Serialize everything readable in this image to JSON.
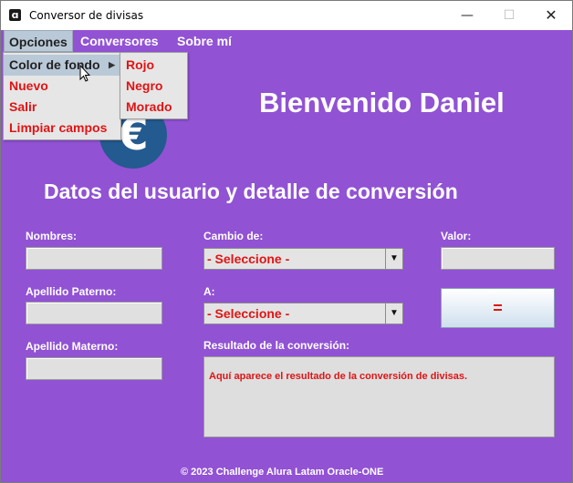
{
  "window": {
    "title": "Conversor de divisas",
    "app_icon": "ɑ",
    "minimize_glyph": "—",
    "maximize_glyph": "☐",
    "close_glyph": "✕"
  },
  "menubar": {
    "items": [
      {
        "label": "Opciones"
      },
      {
        "label": "Conversores"
      },
      {
        "label": "Sobre mí"
      }
    ]
  },
  "opciones_menu": {
    "items": [
      {
        "label": "Color de fondo",
        "has_submenu": true
      },
      {
        "label": "Nuevo"
      },
      {
        "label": "Salir"
      },
      {
        "label": "Limpiar campos"
      }
    ]
  },
  "color_submenu": {
    "items": [
      {
        "label": "Rojo"
      },
      {
        "label": "Negro"
      },
      {
        "label": "Morado"
      }
    ]
  },
  "logo": {
    "glyph": "€",
    "icon": "euro-icon"
  },
  "welcome": "Bienvenido Daniel",
  "section_title": "Datos del usuario y detalle de conversión",
  "form": {
    "nombres_label": "Nombres:",
    "apellido_paterno_label": "Apellido Paterno:",
    "apellido_materno_label": "Apellido Materno:",
    "cambio_de_label": "Cambio de:",
    "cambio_de_value": "- Seleccione -",
    "a_label": "A:",
    "a_value": "- Seleccione -",
    "valor_label": "Valor:",
    "convert_button": "=",
    "resultado_label": "Resultado de la conversión:",
    "resultado_text": "Aquí aparece el resultado de la conversión de divisas."
  },
  "footer": "© 2023 Challenge Alura Latam Oracle-ONE",
  "colors": {
    "background": "#9152d4",
    "accent_text": "#e01414",
    "menu_highlight": "#b9c9d8",
    "logo": "#235a8f"
  }
}
